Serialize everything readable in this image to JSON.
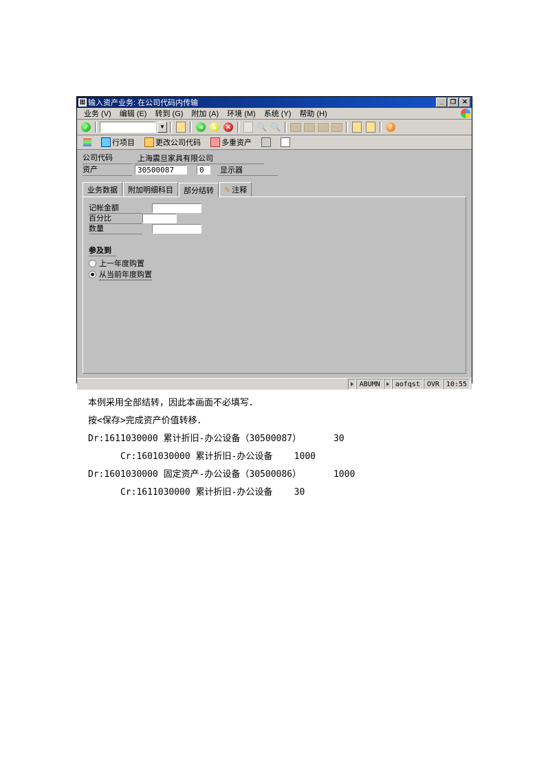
{
  "window": {
    "title": "输入资产业务: 在公司代码内传输",
    "min": "_",
    "restore": "❐",
    "close": "✕"
  },
  "menubar": [
    "业务 (V)",
    "编辑 (E)",
    "转到 (G)",
    "附加 (A)",
    "环境 (M)",
    "系统 (Y)",
    "帮助 (H)"
  ],
  "toolbar2": {
    "line_items": "行项目",
    "change_company": "更改公司代码",
    "multiple_assets": "多重资产"
  },
  "header": {
    "company_code_label": "公司代码",
    "company_name": "上海震旦家具有限公司",
    "asset_label": "资产",
    "asset_no": "30500087",
    "sub_no": "0",
    "asset_desc": "显示器"
  },
  "tabs": [
    "业务数据",
    "附加明细科目",
    "部分结转",
    "注释"
  ],
  "panel": {
    "posting_amount_label": "记帐金额",
    "percent_label": "百分比",
    "quantity_label": "数量",
    "group_heading": "参及到",
    "radio_prev": "上一年度购置",
    "radio_current": "从当前年度购置"
  },
  "status": {
    "tcode": "ABUMN",
    "user": "aofqst",
    "mode": "OVR",
    "time": "10:55"
  },
  "doc": {
    "line1": "本例采用全部结转，因此本画面不必填写．",
    "line2": "按<保存>完成资产价值转移．",
    "line3": "Dr:1611030000 累计折旧-办公设备（30500087）      30",
    "line4": "      Cr:1601030000 累计折旧-办公设备    1000",
    "line5": "Dr:1601030000 固定资产-办公设备（30500086）      1000",
    "line6": "      Cr:1611030000 累计折旧-办公设备    30"
  }
}
